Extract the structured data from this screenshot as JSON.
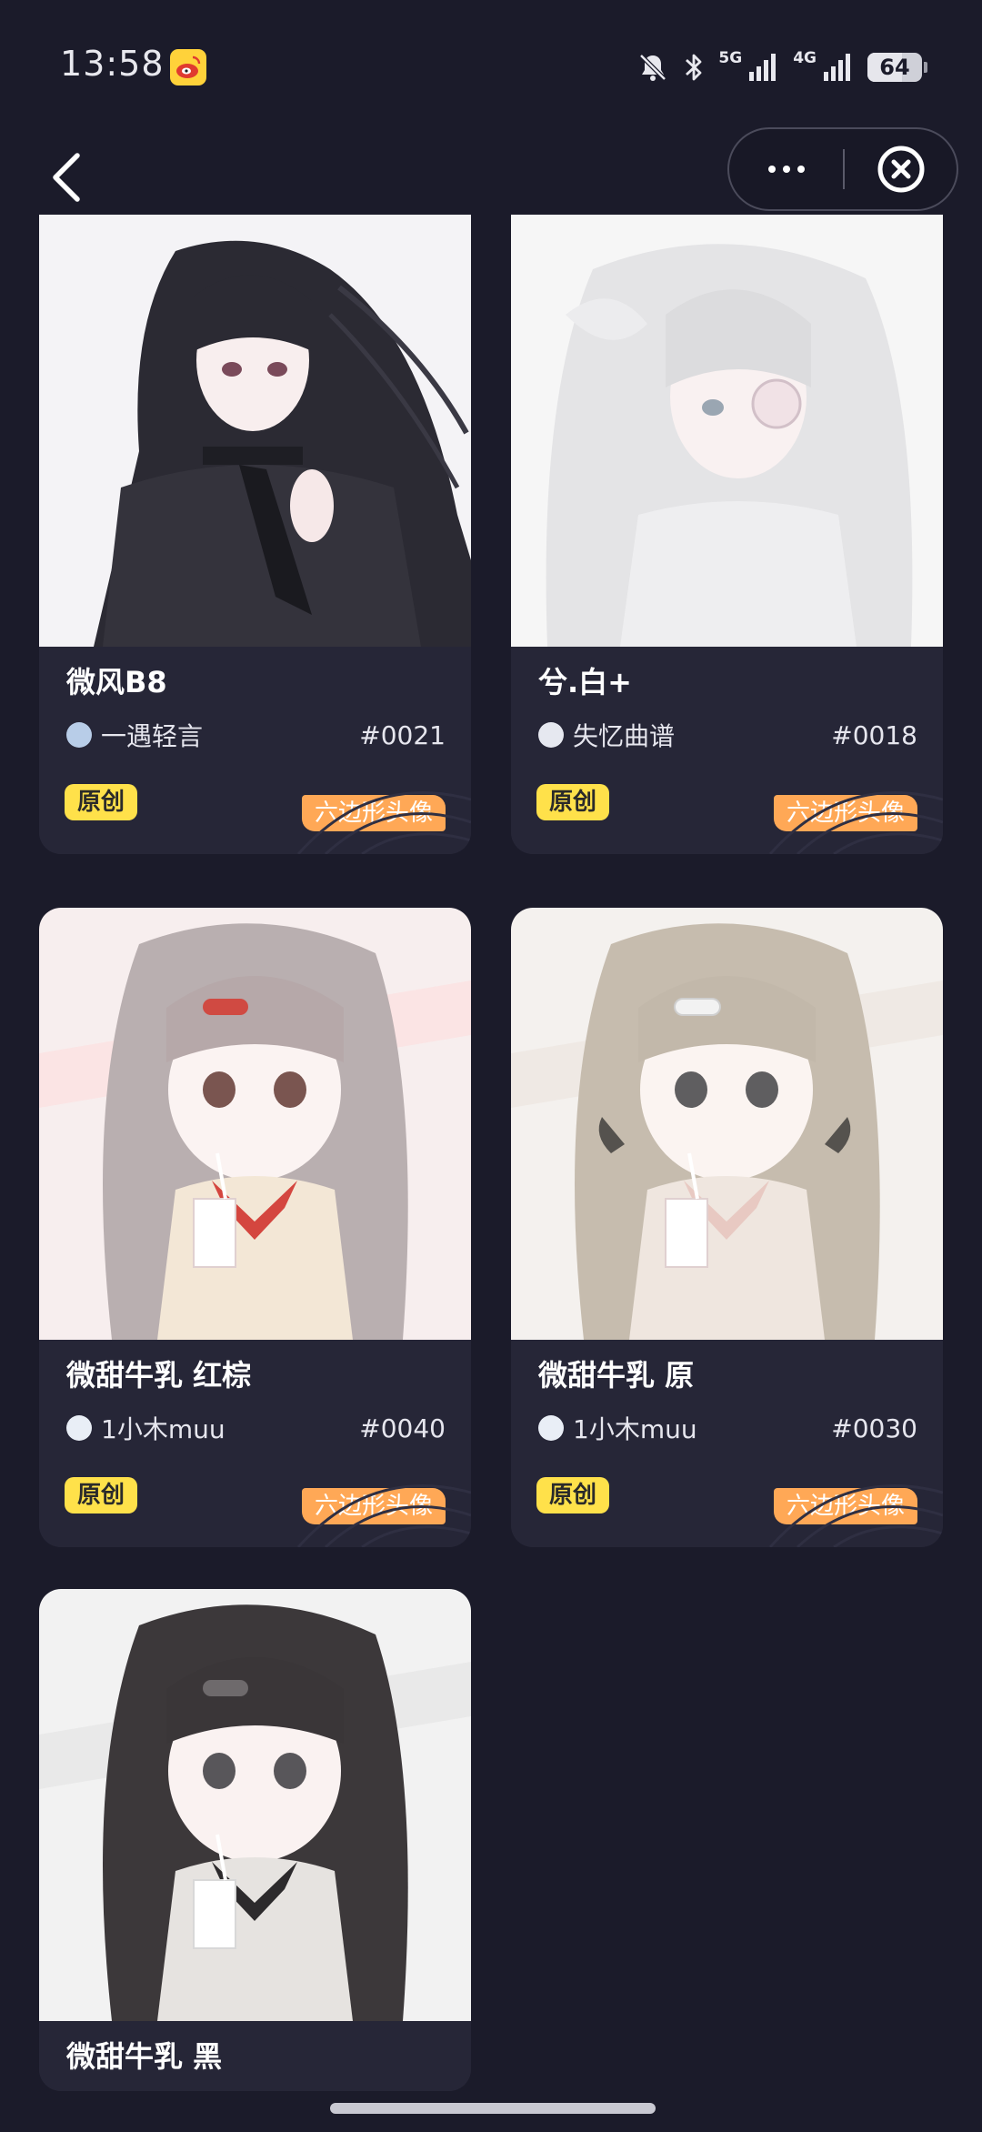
{
  "status_bar": {
    "time": "13:58",
    "network_1": "5G",
    "network_2": "4G",
    "battery": "64",
    "icons": [
      "weibo-icon",
      "bell-off-icon",
      "bluetooth-icon",
      "signal-icon",
      "battery-icon"
    ]
  },
  "nav": {
    "icons": [
      "back-arrow-icon",
      "more-dots-icon",
      "close-circle-icon"
    ]
  },
  "cards": [
    {
      "name": "微风B8",
      "author": "一遇轻言",
      "number": "#0021",
      "tag_original": "原创",
      "tag_type": "六边形头像"
    },
    {
      "name": "兮.白+",
      "author": "失忆曲谱",
      "number": "#0018",
      "tag_original": "原创",
      "tag_type": "六边形头像"
    },
    {
      "name": "微甜牛乳 红棕",
      "author": "1小木muu",
      "number": "#0040",
      "tag_original": "原创",
      "tag_type": "六边形头像"
    },
    {
      "name": "微甜牛乳 原",
      "author": "1小木muu",
      "number": "#0030",
      "tag_original": "原创",
      "tag_type": "六边形头像"
    },
    {
      "name": "微甜牛乳 黑"
    }
  ],
  "colors": {
    "background": "#1b1b2a",
    "card": "#262637",
    "tag_original": "#ffe14a",
    "tag_type": "#ffa856"
  }
}
